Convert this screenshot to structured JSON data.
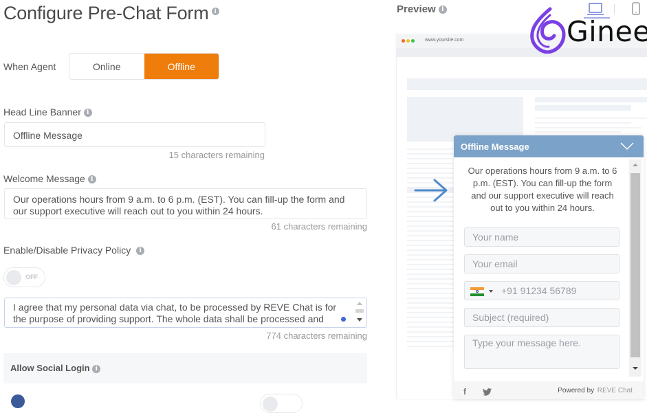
{
  "page": {
    "title": "Configure Pre-Chat Form",
    "info_glyph": "i"
  },
  "agent_status": {
    "label": "When Agent",
    "options": [
      "Online",
      "Offline"
    ],
    "selected": "Offline",
    "accent_color": "#ef7d0c"
  },
  "headline_banner": {
    "label": "Head Line Banner",
    "value": "Offline Message",
    "remaining": "15 characters remaining"
  },
  "welcome_message": {
    "label": "Welcome Message",
    "value": "Our operations hours from 9 a.m. to 6 p.m. (EST). You can fill-up the form and our support executive will reach out to you within 24 hours.",
    "remaining": "61 characters remaining"
  },
  "privacy_policy": {
    "label": "Enable/Disable Privacy Policy",
    "toggle_state": "OFF",
    "text": "I agree that my personal data via chat, to be processed by REVE Chat is for the purpose of providing support. The whole data shall be processed and transmitted in accordance with the General Data Protection Regulation.",
    "remaining": "774 characters remaining"
  },
  "social_login": {
    "label": "Allow Social Login"
  },
  "preview": {
    "label": "Preview",
    "devices": [
      "desktop-icon",
      "mobile-icon"
    ],
    "selected_device": "desktop",
    "url": "www.yoursite.com",
    "logo_text": "Ginee",
    "chat": {
      "header": "Offline Message",
      "header_color": "#7ba2c8",
      "message": "Our operations hours from 9 a.m. to 6 p.m. (EST). You can fill-up the form and our support executive will reach out to you within 24 hours.",
      "fields": {
        "name_placeholder": "Your name",
        "email_placeholder": "Your email",
        "phone_placeholder": "+91 91234 56789",
        "subject_placeholder": "Subject (required)",
        "message_placeholder": "Type your message here."
      },
      "footer": {
        "powered_by": "Powered by",
        "brand": "REVE Chat",
        "social": [
          "facebook-icon",
          "twitter-icon"
        ]
      }
    }
  }
}
